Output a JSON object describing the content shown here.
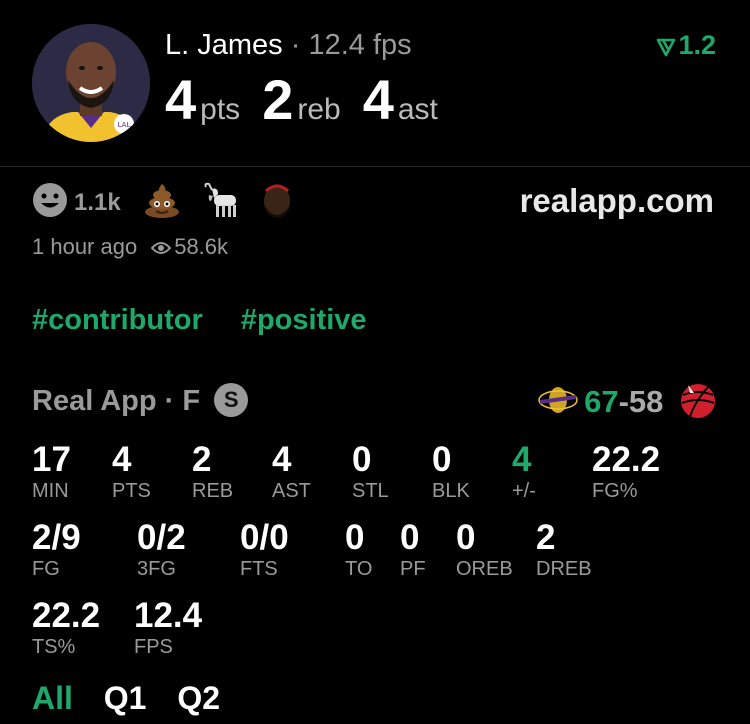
{
  "header": {
    "player_name": "L. James",
    "separator": "·",
    "fps": "12.4 fps",
    "trend_value": "1.2",
    "pts": "4",
    "pts_label": "pts",
    "reb": "2",
    "reb_label": "reb",
    "ast": "4",
    "ast_label": "ast"
  },
  "reactions": {
    "smile_count": "1.1k",
    "emojis": [
      "poop-emoji",
      "goat-emoji",
      "player-face-emoji"
    ],
    "site": "realapp.com"
  },
  "meta": {
    "time_ago": "1 hour ago",
    "views": "58.6k"
  },
  "tags": [
    "#contributor",
    "#positive"
  ],
  "game": {
    "source": "Real App",
    "dot": "·",
    "position": "F",
    "badge": "S",
    "score_home": "67",
    "score_sep": "-",
    "score_away": "58"
  },
  "stats_row1": [
    {
      "value": "17",
      "label": "MIN"
    },
    {
      "value": "4",
      "label": "PTS"
    },
    {
      "value": "2",
      "label": "REB"
    },
    {
      "value": "4",
      "label": "AST"
    },
    {
      "value": "0",
      "label": "STL"
    },
    {
      "value": "0",
      "label": "BLK"
    },
    {
      "value": "4",
      "label": "+/-"
    },
    {
      "value": "22.2",
      "label": "FG%"
    }
  ],
  "stats_row2": [
    {
      "value": "2/9",
      "label": "FG"
    },
    {
      "value": "0/2",
      "label": "3FG"
    },
    {
      "value": "0/0",
      "label": "FTS"
    },
    {
      "value": "0",
      "label": "TO"
    },
    {
      "value": "0",
      "label": "PF"
    },
    {
      "value": "0",
      "label": "OREB"
    },
    {
      "value": "2",
      "label": "DREB"
    }
  ],
  "stats_row3": [
    {
      "value": "22.2",
      "label": "TS%"
    },
    {
      "value": "12.4",
      "label": "FPS"
    }
  ],
  "tabs": [
    "All",
    "Q1",
    "Q2"
  ],
  "colors": {
    "accent": "#1ea86a",
    "muted": "#9a9a9a",
    "background": "#000000"
  }
}
